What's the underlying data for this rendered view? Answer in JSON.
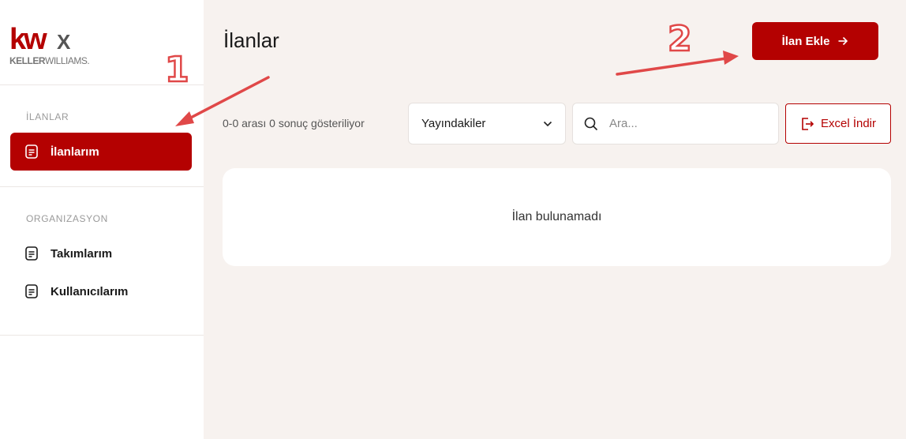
{
  "brand": {
    "logo_mark": "kw",
    "logo_x": "X",
    "logo_sub_bold": "KELLER",
    "logo_sub_light": "WILLIAMS.",
    "color": "#b40101"
  },
  "sidebar": {
    "sections": [
      {
        "label": "İLANLAR",
        "items": [
          {
            "label": "İlanlarım",
            "icon": "document-icon",
            "active": true
          }
        ]
      },
      {
        "label": "ORGANIZASYON",
        "items": [
          {
            "label": "Takımlarım",
            "icon": "document-icon",
            "active": false
          },
          {
            "label": "Kullanıcılarım",
            "icon": "document-icon",
            "active": false
          }
        ]
      }
    ]
  },
  "main": {
    "title": "İlanlar",
    "add_button": "İlan Ekle",
    "result_count": "0-0 arası 0 sonuç gösteriliyor",
    "filter": {
      "selected": "Yayındakiler"
    },
    "search": {
      "placeholder": "Ara...",
      "value": ""
    },
    "excel_button": "Excel İndir",
    "empty_message": "İlan bulunamadı"
  },
  "annotations": [
    {
      "label": "1",
      "color": "#e04848"
    },
    {
      "label": "2",
      "color": "#e04848"
    }
  ]
}
